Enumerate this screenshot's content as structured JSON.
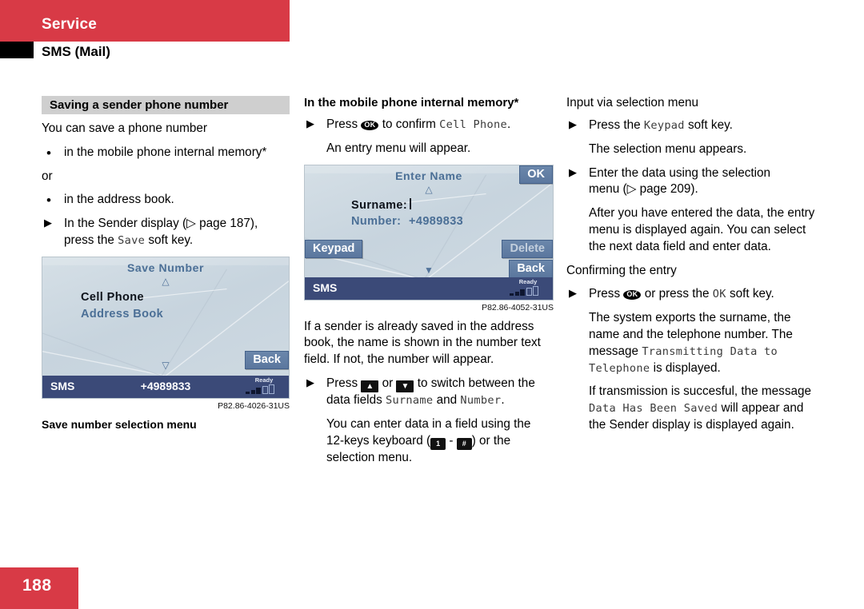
{
  "header": {
    "section": "Service",
    "title": "SMS (Mail)"
  },
  "footer": {
    "page_number": "188"
  },
  "colors": {
    "brand_red": "#d83a46",
    "subhead_gray": "#cfcfcf",
    "screen_blue": "#3b4a78",
    "softkey_blue": "#5b779e"
  },
  "col1": {
    "subhead": "Saving a sender phone number",
    "intro": "You can save a phone number",
    "bullet1": "in the mobile phone internal memory*",
    "or_text": "or",
    "bullet2": "in the address book.",
    "step1_a": "In the Sender display (▷ page 187),",
    "step1_b_pre": "press the ",
    "step1_b_mono": "Save",
    "step1_b_post": " soft key.",
    "figure": {
      "title": "Save Number",
      "up_arrow": "△",
      "down_arrow": "▽",
      "item_selected": "Cell Phone",
      "item_other": "Address Book",
      "softkey_back": "Back",
      "status_label": "SMS",
      "status_number": "+4989833",
      "status_ready": "Ready",
      "code": "P82.86-4026-31US",
      "caption": "Save number selection menu"
    }
  },
  "col2": {
    "subhead": "In the mobile phone internal memory*",
    "step1_pre": "Press ",
    "step1_okkey": "OK",
    "step1_mid": " to confirm ",
    "step1_mono": "Cell Phone",
    "step1_post": ".",
    "step1_note": "An entry menu will appear.",
    "figure": {
      "title": "Enter Name",
      "up_arrow": "△",
      "down_arrow": "▼",
      "field1_label": "Surname:",
      "field1_value": "|",
      "field2_label": "Number:",
      "field2_value": "+4989833",
      "softkey_ok": "OK",
      "softkey_keypad": "Keypad",
      "softkey_delete": "Delete",
      "softkey_back": "Back",
      "status_label": "SMS",
      "status_ready": "Ready",
      "code": "P82.86-4052-31US"
    },
    "para1": "If a sender is already saved in the address book, the name is shown in the number text field. If not, the number will appear.",
    "step2_pre": "Press ",
    "step2_up": "▲",
    "step2_mid": " or ",
    "step2_down": "▼",
    "step2_post": " to switch between the data fields ",
    "step2_mono1": "Surname",
    "step2_and": " and ",
    "step2_mono2": "Number",
    "step2_end": ".",
    "note_a": "You can enter data in a field using the",
    "note_b_pre": "12-keys keyboard (",
    "note_key1": "1",
    "note_dash": " - ",
    "note_key2": "#",
    "note_b_post": ") or the",
    "note_c": "selection menu."
  },
  "col3": {
    "subhead": "Input via selection menu",
    "step1_pre": "Press the ",
    "step1_mono": "Keypad",
    "step1_post": " soft key.",
    "step1_note": "The selection menu appears.",
    "step2_a": "Enter the data using the selection",
    "step2_b": "menu (▷ page 209).",
    "step2_note": "After you have entered the data, the entry menu is displayed again. You can select the next data field and enter data.",
    "subhead2": "Confirming the entry",
    "step3_pre": "Press ",
    "step3_okkey": "OK",
    "step3_mid": " or press the ",
    "step3_mono": "OK",
    "step3_post": " soft key.",
    "note1_pre": "The system exports the surname, the name and the telephone number. The message ",
    "note1_mono": "Transmitting Data to Telephone",
    "note1_post": " is displayed.",
    "note2_pre": "If transmission is succesful, the message ",
    "note2_mono": "Data Has Been Saved",
    "note2_post": " will appear and the Sender display is displayed again."
  }
}
